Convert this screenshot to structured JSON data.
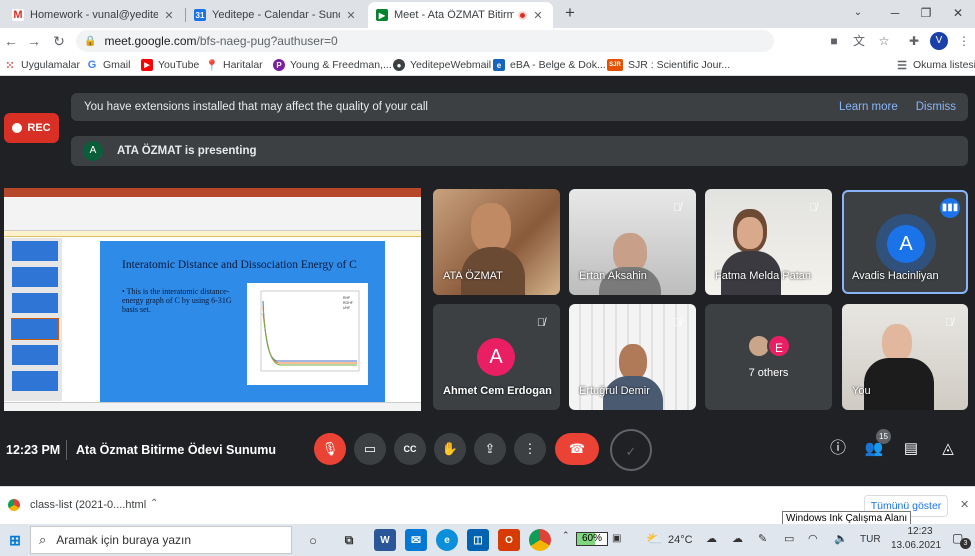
{
  "tabs": [
    {
      "title": "Homework - vunal@yeditepe.edu",
      "icon": "gmail-icon",
      "letter": "M",
      "color": "#d93025"
    },
    {
      "title": "Yeditepe - Calendar - Sunday, Ju",
      "icon": "calendar-icon",
      "letter": "31",
      "color": "#1a73e8"
    },
    {
      "title": "Meet - Ata ÖZMAT Bitirme Ö",
      "icon": "meet-icon",
      "letter": "",
      "color": "#00832d"
    }
  ],
  "new_tab": "+",
  "window_controls": {
    "minimize": "─",
    "restore": "❐",
    "close": "✕"
  },
  "address": {
    "host": "meet.google.com",
    "path": "/bfs-naeg-pug?authuser=0"
  },
  "profile_letter": "V",
  "bookmarks": [
    {
      "label": "Uygulamalar",
      "icon": "apps-grid-icon",
      "color": "#5f6368"
    },
    {
      "label": "Gmail",
      "icon": "google-icon",
      "color": "#4285f4"
    },
    {
      "label": "YouTube",
      "icon": "youtube-icon",
      "color": "#ff0000"
    },
    {
      "label": "Haritalar",
      "icon": "maps-pin-icon",
      "color": "#34a853"
    },
    {
      "label": "Young & Freedman,...",
      "icon": "book-icon",
      "color": "#7b1fa2"
    },
    {
      "label": "YeditepeWebmail",
      "icon": "globe-icon",
      "color": "#3c4043"
    },
    {
      "label": "eBA - Belge & Dok...",
      "icon": "eba-icon",
      "color": "#1565c0"
    },
    {
      "label": "SJR : Scientific Jour...",
      "icon": "sjr-icon",
      "color": "#e65100"
    }
  ],
  "reading_list": "Okuma listesi",
  "meet": {
    "extension_notice": "You have extensions installed that may affect the quality of your call",
    "learn_more": "Learn more",
    "dismiss": "Dismiss",
    "rec_label": "REC",
    "presenter_initial": "A",
    "presenting_text": "ATA ÖZMAT is presenting",
    "slide": {
      "title": "Interatomic Distance and Dissociation Energy of C",
      "bullet": "• This is the interatomic distance-energy graph of C by using 6-31G basis set.",
      "legend": [
        "RHF",
        "ROHF",
        "UHF"
      ]
    },
    "participants": [
      {
        "name": "ATA ÖZMAT",
        "muted": false,
        "type": "video"
      },
      {
        "name": "Ertan Aksahin",
        "muted": true,
        "type": "video"
      },
      {
        "name": "Fatma Melda Patan",
        "muted": true,
        "type": "video"
      },
      {
        "name": "Avadis Hacinliyan",
        "muted": false,
        "type": "avatar",
        "initial": "A",
        "speaking": true
      },
      {
        "name": "Ahmet Cem Erdogan",
        "muted": true,
        "type": "avatar",
        "initial": "A"
      },
      {
        "name": "Ertuğrul Demir",
        "muted": true,
        "type": "video"
      },
      {
        "name": "7 others",
        "muted": false,
        "type": "others",
        "initial": "E"
      },
      {
        "name": "You",
        "muted": true,
        "type": "video"
      }
    ],
    "time": "12:23 PM",
    "meeting_title": "Ata Özmat Bitirme Ödevi Sunumu",
    "people_count": "15"
  },
  "downloads": {
    "file": "class-list (2021-0....html",
    "show_all": "Tümünü göster",
    "tooltip": "Windows Ink Çalışma Alanı"
  },
  "taskbar": {
    "search_placeholder": "Aramak için buraya yazın",
    "battery": "60%",
    "weather": "24°C",
    "lang": "TUR",
    "clock_time": "12:23",
    "clock_date": "13.06.2021",
    "notif_count": "3"
  }
}
